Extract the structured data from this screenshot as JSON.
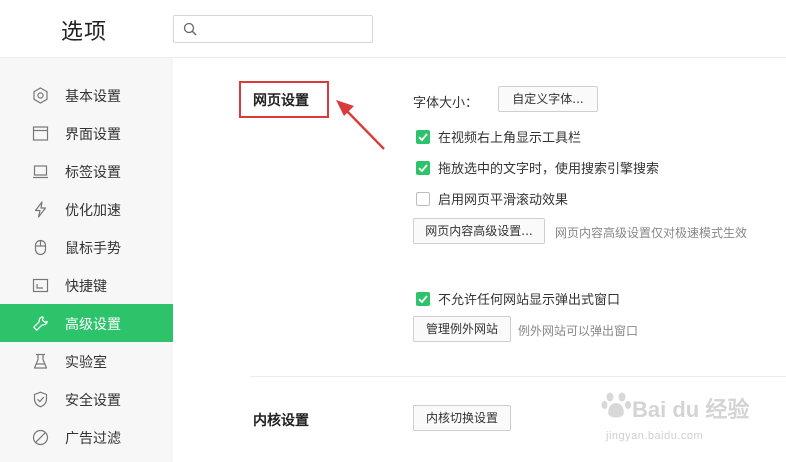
{
  "header": {
    "title": "选项",
    "search": {
      "value": "",
      "placeholder": ""
    }
  },
  "sidebar": {
    "items": [
      {
        "label": "基本设置",
        "icon": "gear-icon",
        "active": false
      },
      {
        "label": "界面设置",
        "icon": "window-icon",
        "active": false
      },
      {
        "label": "标签设置",
        "icon": "tab-icon",
        "active": false
      },
      {
        "label": "优化加速",
        "icon": "lightning-icon",
        "active": false
      },
      {
        "label": "鼠标手势",
        "icon": "mouse-icon",
        "active": false
      },
      {
        "label": "快捷键",
        "icon": "keyboard-icon",
        "active": false
      },
      {
        "label": "高级设置",
        "icon": "wrench-icon",
        "active": true
      },
      {
        "label": "实验室",
        "icon": "flask-icon",
        "active": false
      },
      {
        "label": "安全设置",
        "icon": "shield-icon",
        "active": false
      },
      {
        "label": "广告过滤",
        "icon": "block-icon",
        "active": false
      }
    ]
  },
  "web_section": {
    "title": "网页设置",
    "font_size_label": "字体大小：",
    "custom_font_button": "自定义字体...",
    "checkboxes": [
      {
        "label": "在视频右上角显示工具栏",
        "checked": true
      },
      {
        "label": "拖放选中的文字时，使用搜索引擎搜索",
        "checked": true
      },
      {
        "label": "启用网页平滑滚动效果",
        "checked": false
      }
    ],
    "advanced_button": "网页内容高级设置...",
    "advanced_hint": "网页内容高级设置仅对极速模式生效",
    "popup_checkbox": {
      "label": "不允许任何网站显示弹出式窗口",
      "checked": true
    },
    "manage_exceptions_button": "管理例外网站",
    "exceptions_hint": "例外网站可以弹出窗口"
  },
  "kernel_section": {
    "title": "内核设置",
    "switch_button": "内核切换设置"
  },
  "colors": {
    "accent": "#2dc36b",
    "highlight_box": "#d93a3a",
    "sidebar_bg": "#f7f7f7"
  },
  "watermark": {
    "brand": "Bai du 经验",
    "url": "jingyan.baidu.com"
  }
}
